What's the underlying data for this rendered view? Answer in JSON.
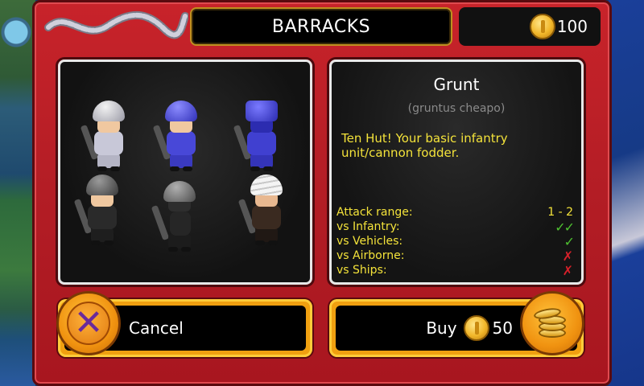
{
  "header": {
    "title": "BARRACKS",
    "coin_count": "100"
  },
  "units": [
    {
      "name": "unit-grey-rifleman",
      "style": "u-grey"
    },
    {
      "name": "unit-blue-bazooka",
      "style": "u-blue"
    },
    {
      "name": "unit-blue-heavy",
      "style": "u-blue2"
    },
    {
      "name": "unit-black-soldier",
      "style": "u-black"
    },
    {
      "name": "unit-black-gunner",
      "style": "u-black2"
    },
    {
      "name": "unit-bandana-soldier",
      "style": "u-band"
    }
  ],
  "info": {
    "name": "Grunt",
    "latin": "(gruntus cheapo)",
    "description": "Ten Hut! Your basic infantry unit/cannon fodder.",
    "stats": [
      {
        "label": "Attack range:",
        "value": "1 - 2",
        "kind": "text"
      },
      {
        "label": "vs Infantry:",
        "value": "✓✓",
        "kind": "check"
      },
      {
        "label": "vs Vehicles:",
        "value": "✓",
        "kind": "check"
      },
      {
        "label": "vs Airborne:",
        "value": "✗",
        "kind": "cross"
      },
      {
        "label": "vs Ships:",
        "value": "✗",
        "kind": "cross"
      }
    ]
  },
  "buttons": {
    "cancel_label": "Cancel",
    "buy_label": "Buy",
    "buy_price": "50"
  },
  "colors": {
    "frame_red": "#c8232a",
    "accent_gold": "#f0a010",
    "text_yellow": "#f4e33a",
    "check_green": "#4ec030",
    "cross_red": "#d8202a"
  }
}
